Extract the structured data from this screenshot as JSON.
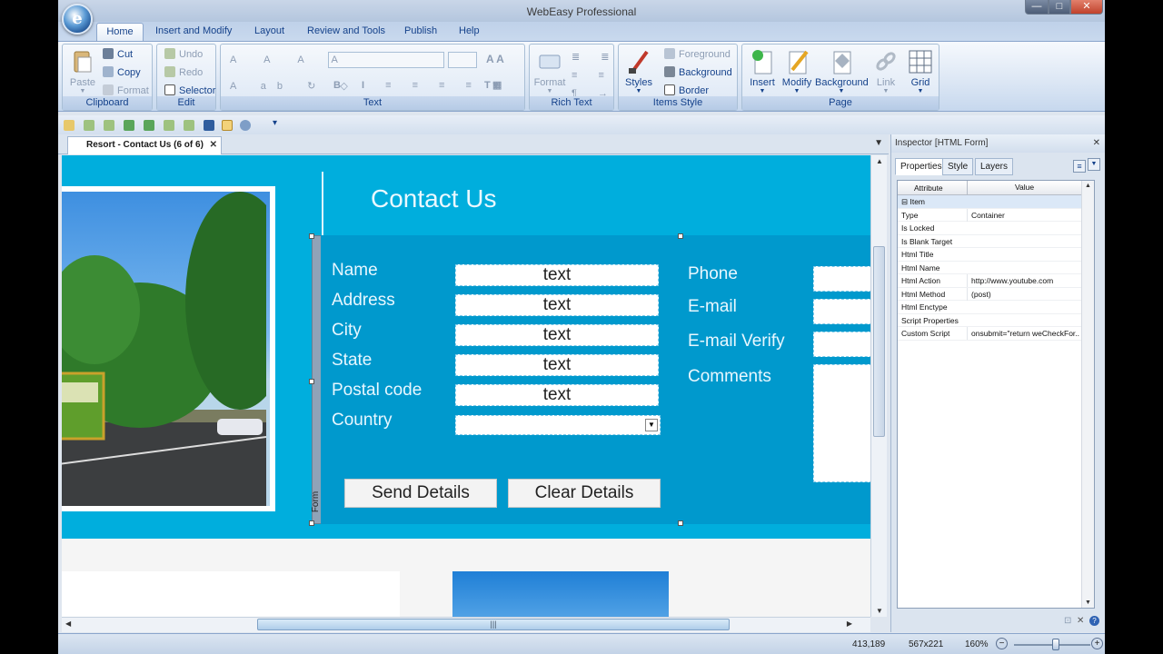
{
  "window": {
    "title": "WebEasy Professional",
    "min": "—",
    "max": "□",
    "close": "✕"
  },
  "ribbon_tabs": [
    "Home",
    "Insert and Modify",
    "Layout",
    "Review and Tools",
    "Publish",
    "Help"
  ],
  "clipboard": {
    "label": "Clipboard",
    "paste": "Paste",
    "cut": "Cut",
    "copy": "Copy",
    "format": "Format"
  },
  "edit": {
    "label": "Edit",
    "undo": "Undo",
    "redo": "Redo",
    "selector": "Selector"
  },
  "text_group": {
    "label": "Text"
  },
  "rich_text": {
    "label": "Rich Text",
    "format": "Format"
  },
  "items_style": {
    "label": "Items Style",
    "styles": "Styles",
    "foreground": "Foreground",
    "background": "Background",
    "border": "Border"
  },
  "page_group": {
    "label": "Page",
    "insert": "Insert",
    "modify": "Modify",
    "background": "Background",
    "link": "Link",
    "grid": "Grid"
  },
  "doc_tab": {
    "title": "Resort - Contact Us (6 of 6)",
    "close": "✕"
  },
  "page": {
    "title": "Contact Us",
    "form_strip_label": "Form",
    "left_fields": [
      {
        "label": "Name",
        "value": "text"
      },
      {
        "label": "Address",
        "value": "text"
      },
      {
        "label": "City",
        "value": "text"
      },
      {
        "label": "State",
        "value": "text"
      },
      {
        "label": "Postal code",
        "value": "text"
      }
    ],
    "country_label": "Country",
    "right_labels": [
      "Phone",
      "E-mail",
      "E-mail Verify",
      "Comments"
    ],
    "send_button": "Send Details",
    "clear_button": "Clear Details"
  },
  "inspector": {
    "title": "Inspector [HTML Form]",
    "tabs": [
      "Properties",
      "Style",
      "Layers"
    ],
    "col_attribute": "Attribute",
    "col_value": "Value",
    "rows": [
      {
        "k": "⊟ Item",
        "v": ""
      },
      {
        "k": "Type",
        "v": "Container"
      },
      {
        "k": "Is Locked",
        "v": ""
      },
      {
        "k": "Is Blank Target",
        "v": ""
      },
      {
        "k": "Html Title",
        "v": ""
      },
      {
        "k": "Html Name",
        "v": ""
      },
      {
        "k": "Html Action",
        "v": "http://www.youtube.com"
      },
      {
        "k": "Html Method",
        "v": "(post)"
      },
      {
        "k": "Html Enctype",
        "v": ""
      },
      {
        "k": "Script Properties",
        "v": ""
      },
      {
        "k": "Custom Script",
        "v": "onsubmit=\"return weCheckFor..."
      }
    ]
  },
  "status": {
    "coords": "413,189",
    "size": "567x221",
    "zoom": "160%"
  }
}
